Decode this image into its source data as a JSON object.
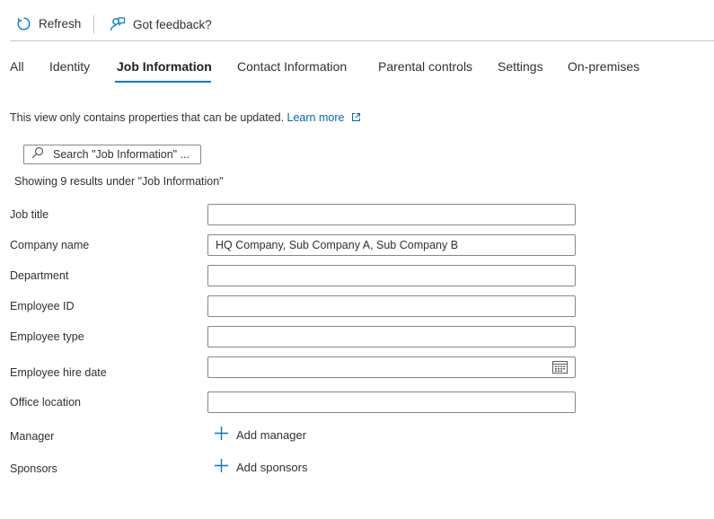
{
  "toolbar": {
    "refresh_label": "Refresh",
    "feedback_label": "Got feedback?"
  },
  "tabs": [
    {
      "label": "All"
    },
    {
      "label": "Identity"
    },
    {
      "label": "Job Information"
    },
    {
      "label": "Contact Information"
    },
    {
      "label": "Parental controls"
    },
    {
      "label": "Settings"
    },
    {
      "label": "On-premises"
    }
  ],
  "active_tab": "Job Information",
  "info": {
    "text": "This view only contains properties that can be updated.",
    "link": "Learn more"
  },
  "search": {
    "placeholder": "Search \"Job Information\" ..."
  },
  "results_text": "Showing 9 results under \"Job Information\"",
  "fields": {
    "job_title": {
      "label": "Job title",
      "value": ""
    },
    "company_name": {
      "label": "Company name",
      "value": "HQ Company, Sub Company A, Sub Company B"
    },
    "department": {
      "label": "Department",
      "value": ""
    },
    "employee_id": {
      "label": "Employee ID",
      "value": ""
    },
    "employee_type": {
      "label": "Employee type",
      "value": ""
    },
    "hire_date": {
      "label": "Employee hire date",
      "value": ""
    },
    "office_location": {
      "label": "Office location",
      "value": ""
    },
    "manager": {
      "label": "Manager",
      "action": "Add manager"
    },
    "sponsors": {
      "label": "Sponsors",
      "action": "Add sponsors"
    }
  },
  "colors": {
    "accent": "#0078d4",
    "link": "#0067b8",
    "border": "#8a8886",
    "text": "#323130"
  }
}
